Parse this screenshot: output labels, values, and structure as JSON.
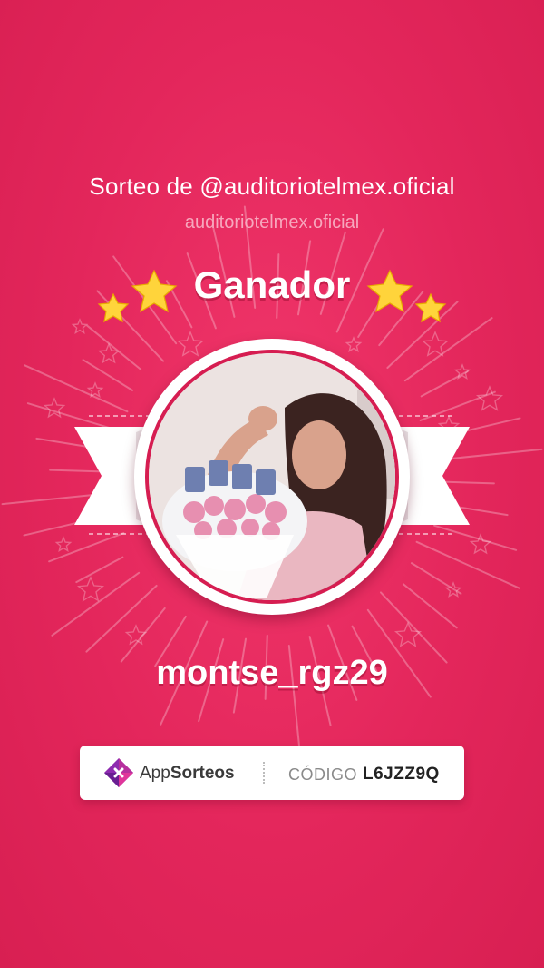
{
  "header": {
    "title": "Sorteo de @auditoriotelmex.oficial",
    "account": "auditoriotelmex.oficial",
    "heading": "Ganador"
  },
  "winner": {
    "username": "montse_rgz29",
    "photo": "winner-profile-photo"
  },
  "footer": {
    "brand_prefix": "App",
    "brand_suffix": "Sorteos",
    "code_label": "CÓDIGO",
    "code_value": "L6JZZ9Q"
  },
  "colors": {
    "background": "#e3265b",
    "star": "#ffd43b",
    "ribbon": "#ffffff",
    "brand_purple": "#8e2bb0",
    "brand_pink": "#e0359a"
  }
}
